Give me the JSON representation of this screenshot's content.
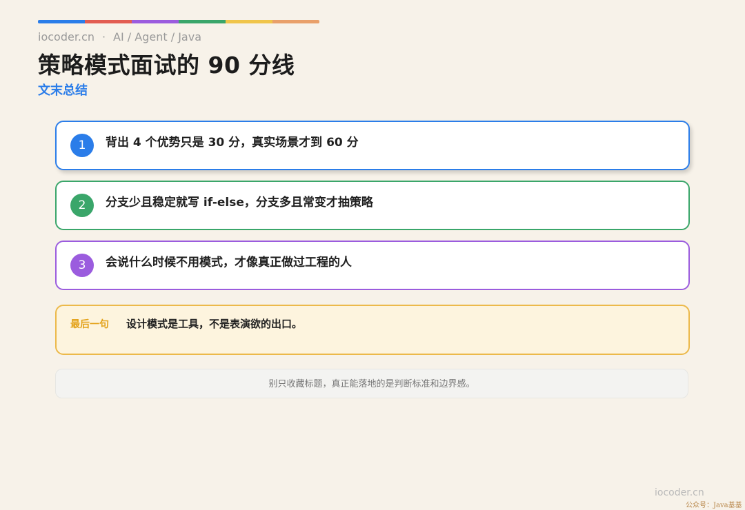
{
  "colors": {
    "background": "#f7f2e9",
    "accent_blue": "#2b7de9",
    "accent_green": "#3aa66a",
    "accent_purple": "#9b5cde",
    "accent_yellow": "#ecb94a",
    "topbar": [
      "#2b7de9",
      "#e25d52",
      "#9b5cde",
      "#3aa66a",
      "#f0c54a",
      "#e9a06a"
    ]
  },
  "header": {
    "site": "iocoder.cn",
    "separator": "·",
    "category": "AI / Agent / Java",
    "title": "策略模式面试的 90 分线",
    "subtitle": "文末总结"
  },
  "points": [
    {
      "number": "1",
      "text": "背出 4 个优势只是 30 分，真实场景才到 60 分"
    },
    {
      "number": "2",
      "text": "分支少且稳定就写 if-else，分支多且常变才抽策略"
    },
    {
      "number": "3",
      "text": "会说什么时候不用模式，才像真正做过工程的人"
    }
  ],
  "final": {
    "label": "最后一句",
    "text": "设计模式是工具，不是表演欲的出口。"
  },
  "note": "别只收藏标题，真正能落地的是判断标准和边界感。",
  "footer": {
    "brand": "iocoder.cn",
    "watermark": "公众号：Java基基"
  }
}
